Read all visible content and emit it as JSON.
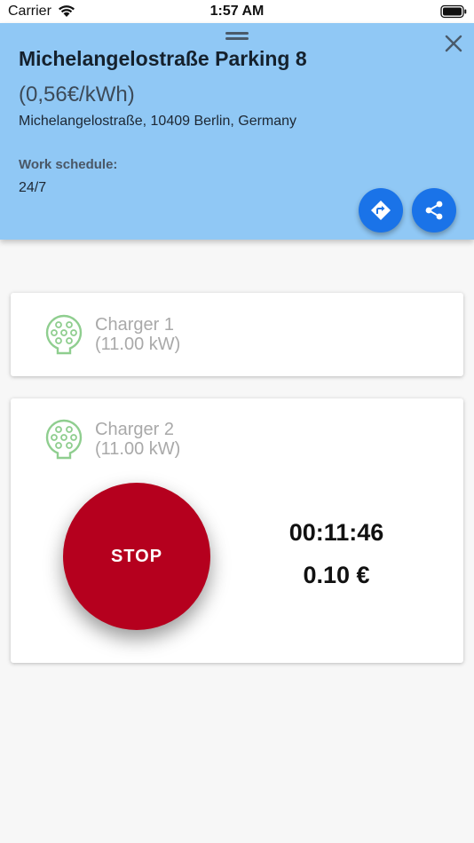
{
  "status_bar": {
    "carrier": "Carrier",
    "time": "1:57 AM"
  },
  "station": {
    "name": "Michelangelostraße Parking 8",
    "price": "(0,56€/kWh)",
    "address": "Michelangelostraße, 10409 Berlin, Germany",
    "schedule_label": "Work schedule:",
    "schedule": "24/7"
  },
  "chargers": [
    {
      "name": "Charger 1",
      "power": "(11.00 kW)"
    },
    {
      "name": "Charger 2",
      "power": "(11.00 kW)"
    }
  ],
  "session": {
    "stop_label": "STOP",
    "elapsed": "00:11:46",
    "cost": "0.10 €"
  },
  "colors": {
    "panel": "#90c8f5",
    "fab": "#1a73e8",
    "stop": "#b5001e",
    "plug": "#8fce8f"
  },
  "icons": [
    "wifi-icon",
    "battery-icon",
    "drag-handle-icon",
    "close-icon",
    "directions-icon",
    "share-icon",
    "type2-plug-icon"
  ]
}
